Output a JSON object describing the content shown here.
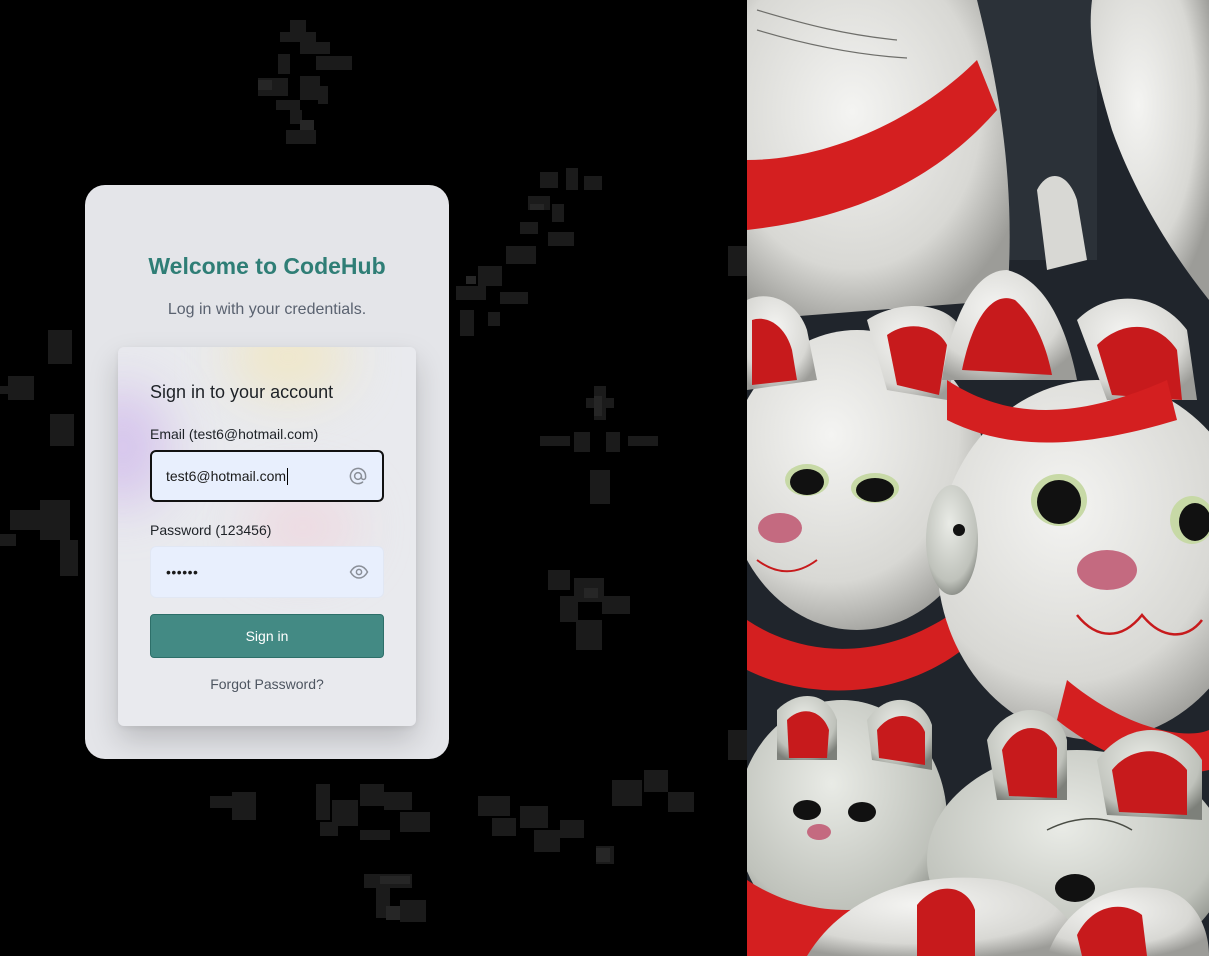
{
  "welcome": {
    "title": "Welcome to CodeHub",
    "subtitle": "Log in with your credentials."
  },
  "form": {
    "heading": "Sign in to your account",
    "email": {
      "label": "Email (test6@hotmail.com)",
      "value": "test6@hotmail.com",
      "icon": "at-sign-icon"
    },
    "password": {
      "label": "Password (123456)",
      "value": "••••••",
      "icon": "eye-icon"
    },
    "submit_label": "Sign in",
    "forgot_label": "Forgot Password?"
  },
  "colors": {
    "accent": "#2f7e76",
    "button": "#438a84",
    "card": "#e4e5e9",
    "input_bg": "#e8effd"
  },
  "decor": {
    "left_background": "pixel-art-noise",
    "right_image": "maneki-neko-cat-figurines"
  }
}
